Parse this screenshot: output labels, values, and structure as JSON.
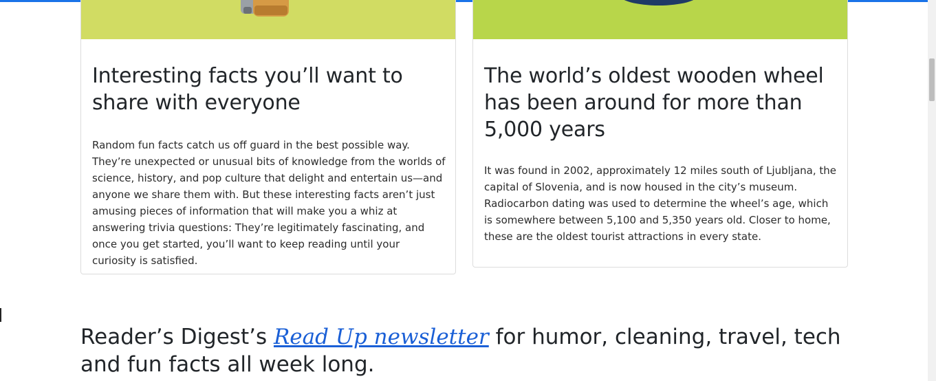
{
  "colors": {
    "top_bar": "#1a73e8",
    "card_left_image_bg": "#d1dc63",
    "card_right_image_bg": "#b8d64a",
    "link": "#1a5fd6"
  },
  "cards": [
    {
      "title": "Interesting facts you’ll want to share with everyone",
      "text": "Random fun facts catch us off guard in the best possible way. They’re unexpected or unusual bits of knowledge from the worlds of science, history, and pop culture that delight and entertain us—and anyone we share them with. But these interesting facts aren’t just amusing pieces of information that will make you a whiz at answering trivia questions: They’re legitimately fascinating, and once you get started, you’ll want to keep reading until your curiosity is satisfied."
    },
    {
      "title": "The world’s oldest wooden wheel has been around for more than 5,000 years",
      "text": "It was found in 2002, approximately 12 miles south of Ljubljana, the capital of Slovenia, and is now housed in the city’s museum. Radiocarbon dating was used to determine the wheel’s age, which is somewhere between 5,100 and 5,350 years old. Closer to home, these are the oldest tourist attractions in every state."
    }
  ],
  "newsletter": {
    "prefix": "Reader’s Digest’s ",
    "link_text": "Read Up newsletter",
    "suffix": " for humor, cleaning, travel, tech and fun facts all week long."
  }
}
